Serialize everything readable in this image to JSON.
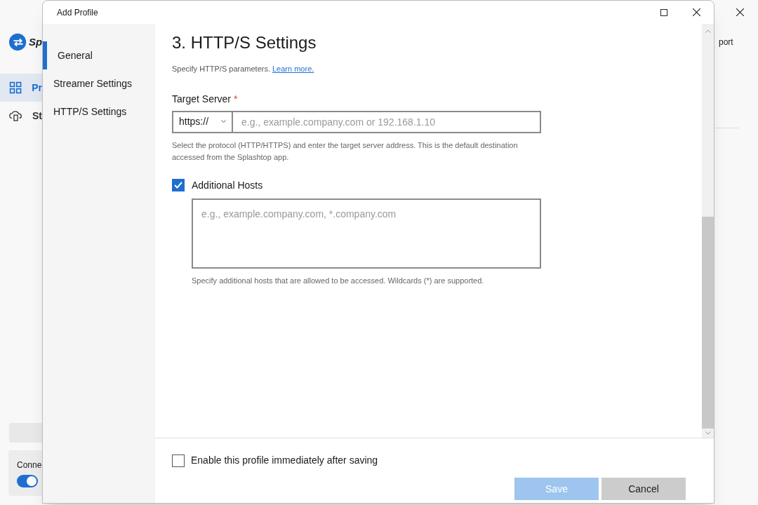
{
  "background_app": {
    "logo_text": "Sp",
    "nav_items": [
      {
        "label": "Pr",
        "selected": true
      },
      {
        "label": "St",
        "selected": false
      }
    ],
    "status_label": "Conne",
    "toggle": {
      "on": true
    },
    "header_text": "port"
  },
  "dialog": {
    "title": "Add Profile",
    "nav": [
      {
        "label": "General",
        "selected": true
      },
      {
        "label": "Streamer Settings",
        "selected": false
      },
      {
        "label": "HTTP/S Settings",
        "selected": false
      }
    ],
    "heading": "3. HTTP/S Settings",
    "intro": "Specify HTTP/S parameters.",
    "learn_more": "Learn more.",
    "target_server": {
      "label": "Target Server",
      "required_mark": "*",
      "protocol": "https://",
      "placeholder": "e.g., example.company.com or 192.168.1.10",
      "help": "Select the protocol (HTTP/HTTPS) and enter the target server address. This is the default destination accessed from the Splashtop app."
    },
    "additional_hosts": {
      "label": "Additional Hosts",
      "checked": true,
      "placeholder": "e.g., example.company.com, *.company.com",
      "help": "Specify additional hosts that are allowed to be accessed. Wildcards (*) are supported."
    },
    "enable_checkbox": {
      "label": "Enable this profile immediately after saving",
      "checked": false
    },
    "buttons": [
      {
        "label": "Save",
        "disabled": true
      },
      {
        "label": "Cancel",
        "disabled": false
      }
    ]
  }
}
